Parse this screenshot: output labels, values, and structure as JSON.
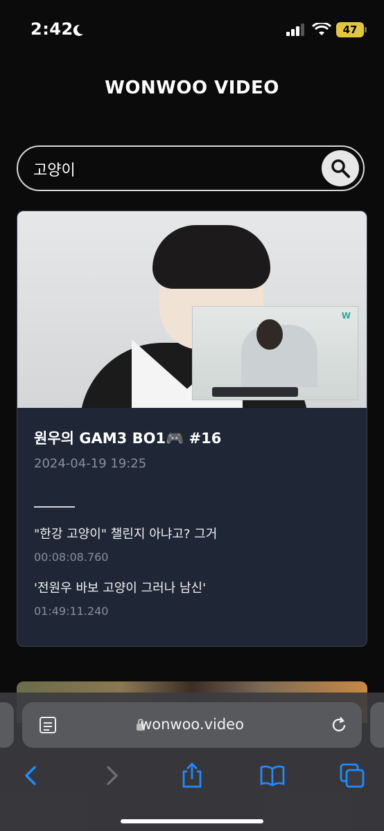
{
  "status_bar": {
    "time": "2:42",
    "battery": "47"
  },
  "header": {
    "title": "WONWOO VIDEO"
  },
  "search": {
    "value": "고양이"
  },
  "results": [
    {
      "title": "원우의 GAM3 BO1🎮 #16",
      "date": "2024-04-19 19:25",
      "hits": [
        {
          "text": "\"한강 고양이\" 챌린지 아냐고? 그거",
          "time": "00:08:08.760"
        },
        {
          "text": "'전원우 바보 고양이 그러나 남신'",
          "time": "01:49:11.240"
        }
      ]
    }
  ],
  "browser": {
    "url": "wonwoo.video"
  },
  "colors": {
    "accent": "#1f8bff",
    "card_bg": "#1f2737",
    "battery": "#e2c73d"
  }
}
